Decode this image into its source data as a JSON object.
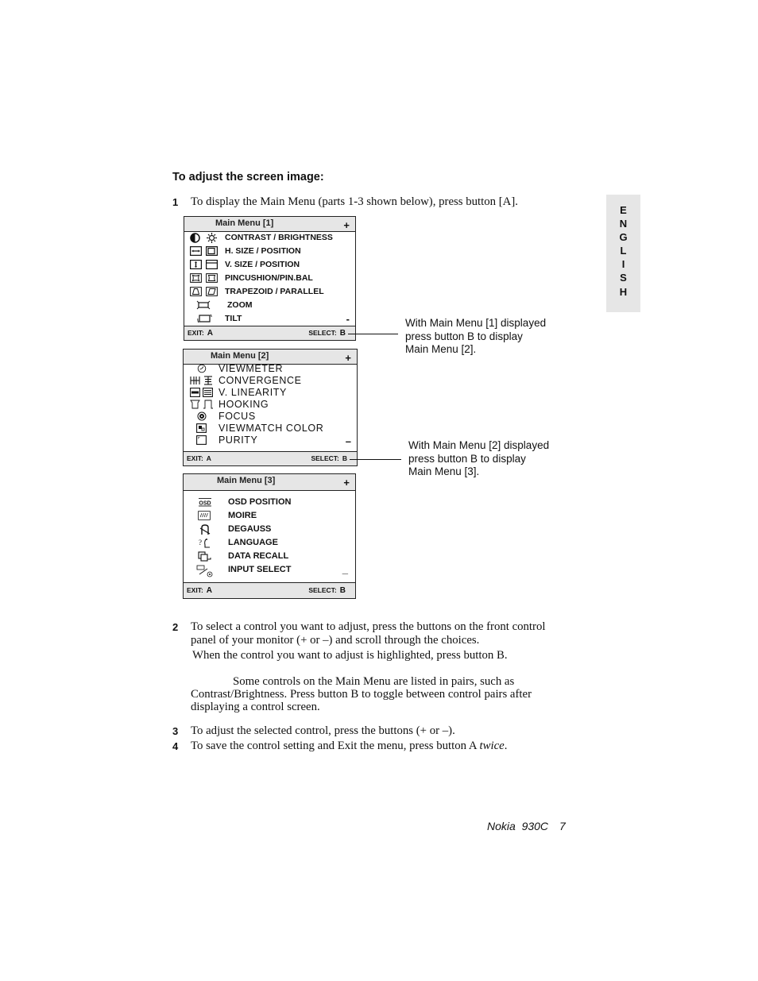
{
  "heading": "To adjust the screen image:",
  "steps": {
    "s1": {
      "num": "1",
      "text": "To display the Main Menu (parts 1-3 shown below), press button [A]."
    },
    "s2": {
      "num": "2",
      "line1": "To select a control you want to adjust, press the buttons on the front control",
      "line2": "panel of your monitor (+ or –) and scroll through the choices.",
      "line3": "When the control you want to adjust is highlighted, press button B."
    },
    "note": {
      "line1": "Some controls on the Main Menu are listed in pairs, such as",
      "line2": "Contrast/Brightness. Press button B to toggle between control pairs after",
      "line3": "displaying a control screen."
    },
    "s3": {
      "num": "3",
      "text": "To adjust the selected control, press the buttons (+ or –)."
    },
    "s4": {
      "num": "4",
      "text_before": "To save the control setting and Exit the menu, press button A ",
      "text_italic": "twice",
      "text_after": "."
    }
  },
  "menus": [
    {
      "title": "Main Menu [1]",
      "plus": "+",
      "minus": "-",
      "exit_label": "EXIT:",
      "exit_key": "A",
      "select_label": "SELECT:",
      "select_key": "B",
      "items": [
        {
          "label": "CONTRAST / BRIGHTNESS",
          "icons": [
            "contrast-icon",
            "brightness-icon"
          ]
        },
        {
          "label": "H. SIZE / POSITION",
          "icons": [
            "h-size-icon",
            "h-position-icon"
          ]
        },
        {
          "label": "V. SIZE / POSITION",
          "icons": [
            "v-size-icon",
            "v-position-icon"
          ]
        },
        {
          "label": "PINCUSHION/PIN.BAL",
          "icons": [
            "pincushion-icon",
            "pin-balance-icon"
          ]
        },
        {
          "label": "TRAPEZOID / PARALLEL",
          "icons": [
            "trapezoid-icon",
            "parallel-icon"
          ]
        },
        {
          "label": "ZOOM",
          "icons": [
            "zoom-icon"
          ]
        },
        {
          "label": "TILT",
          "icons": [
            "tilt-icon"
          ]
        }
      ]
    },
    {
      "title": "Main Menu [2]",
      "plus": "+",
      "minus": "–",
      "exit_label": "EXIT:",
      "exit_key": "A",
      "select_label": "SELECT:",
      "select_key": "B",
      "items": [
        {
          "label": "VIEWMETER",
          "icons": [
            "viewmeter-icon"
          ]
        },
        {
          "label": "CONVERGENCE",
          "icons": [
            "h-convergence-icon",
            "v-convergence-icon"
          ]
        },
        {
          "label": "V. LINEARITY",
          "icons": [
            "v-linearity-icon",
            "v-linearity-balance-icon"
          ]
        },
        {
          "label": "HOOKING",
          "icons": [
            "hooking-icon",
            "hooking-alt-icon"
          ]
        },
        {
          "label": "FOCUS",
          "icons": [
            "focus-icon"
          ]
        },
        {
          "label": "VIEWMATCH COLOR",
          "icons": [
            "viewmatch-color-icon"
          ]
        },
        {
          "label": "PURITY",
          "icons": [
            "purity-icon"
          ]
        }
      ]
    },
    {
      "title": "Main Menu [3]",
      "plus": "+",
      "minus": "_",
      "exit_label": "EXIT:",
      "exit_key": "A",
      "select_label": "SELECT:",
      "select_key": "B",
      "items": [
        {
          "label": "OSD POSITION",
          "icons": [
            "osd-position-icon"
          ],
          "icon_text": "OSD"
        },
        {
          "label": "MOIRE",
          "icons": [
            "moire-icon"
          ]
        },
        {
          "label": "DEGAUSS",
          "icons": [
            "degauss-icon"
          ]
        },
        {
          "label": "LANGUAGE",
          "icons": [
            "language-icon"
          ]
        },
        {
          "label": "DATA RECALL",
          "icons": [
            "data-recall-icon"
          ]
        },
        {
          "label": "INPUT SELECT",
          "icons": [
            "input-select-icon"
          ]
        }
      ]
    }
  ],
  "callouts": [
    {
      "line1": "With Main Menu [1] displayed",
      "line2": "press button B to display",
      "line3": "Main Menu [2]."
    },
    {
      "line1": "With Main Menu [2] displayed",
      "line2": "press button B to display",
      "line3": "Main Menu [3]."
    }
  ],
  "side_tab": {
    "letters": [
      "E",
      "N",
      "G",
      "L",
      "I",
      "S",
      "H"
    ]
  },
  "footer": {
    "product": "Nokia  930C",
    "page": "7"
  }
}
